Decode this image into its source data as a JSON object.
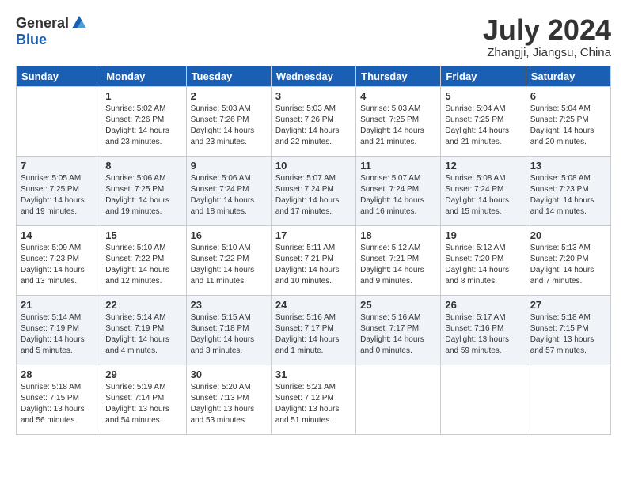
{
  "header": {
    "logo_general": "General",
    "logo_blue": "Blue",
    "month_title": "July 2024",
    "location": "Zhangji, Jiangsu, China"
  },
  "days_of_week": [
    "Sunday",
    "Monday",
    "Tuesday",
    "Wednesday",
    "Thursday",
    "Friday",
    "Saturday"
  ],
  "weeks": [
    [
      {
        "day": "",
        "info": ""
      },
      {
        "day": "1",
        "info": "Sunrise: 5:02 AM\nSunset: 7:26 PM\nDaylight: 14 hours\nand 23 minutes."
      },
      {
        "day": "2",
        "info": "Sunrise: 5:03 AM\nSunset: 7:26 PM\nDaylight: 14 hours\nand 23 minutes."
      },
      {
        "day": "3",
        "info": "Sunrise: 5:03 AM\nSunset: 7:26 PM\nDaylight: 14 hours\nand 22 minutes."
      },
      {
        "day": "4",
        "info": "Sunrise: 5:03 AM\nSunset: 7:25 PM\nDaylight: 14 hours\nand 21 minutes."
      },
      {
        "day": "5",
        "info": "Sunrise: 5:04 AM\nSunset: 7:25 PM\nDaylight: 14 hours\nand 21 minutes."
      },
      {
        "day": "6",
        "info": "Sunrise: 5:04 AM\nSunset: 7:25 PM\nDaylight: 14 hours\nand 20 minutes."
      }
    ],
    [
      {
        "day": "7",
        "info": "Sunrise: 5:05 AM\nSunset: 7:25 PM\nDaylight: 14 hours\nand 19 minutes."
      },
      {
        "day": "8",
        "info": "Sunrise: 5:06 AM\nSunset: 7:25 PM\nDaylight: 14 hours\nand 19 minutes."
      },
      {
        "day": "9",
        "info": "Sunrise: 5:06 AM\nSunset: 7:24 PM\nDaylight: 14 hours\nand 18 minutes."
      },
      {
        "day": "10",
        "info": "Sunrise: 5:07 AM\nSunset: 7:24 PM\nDaylight: 14 hours\nand 17 minutes."
      },
      {
        "day": "11",
        "info": "Sunrise: 5:07 AM\nSunset: 7:24 PM\nDaylight: 14 hours\nand 16 minutes."
      },
      {
        "day": "12",
        "info": "Sunrise: 5:08 AM\nSunset: 7:24 PM\nDaylight: 14 hours\nand 15 minutes."
      },
      {
        "day": "13",
        "info": "Sunrise: 5:08 AM\nSunset: 7:23 PM\nDaylight: 14 hours\nand 14 minutes."
      }
    ],
    [
      {
        "day": "14",
        "info": "Sunrise: 5:09 AM\nSunset: 7:23 PM\nDaylight: 14 hours\nand 13 minutes."
      },
      {
        "day": "15",
        "info": "Sunrise: 5:10 AM\nSunset: 7:22 PM\nDaylight: 14 hours\nand 12 minutes."
      },
      {
        "day": "16",
        "info": "Sunrise: 5:10 AM\nSunset: 7:22 PM\nDaylight: 14 hours\nand 11 minutes."
      },
      {
        "day": "17",
        "info": "Sunrise: 5:11 AM\nSunset: 7:21 PM\nDaylight: 14 hours\nand 10 minutes."
      },
      {
        "day": "18",
        "info": "Sunrise: 5:12 AM\nSunset: 7:21 PM\nDaylight: 14 hours\nand 9 minutes."
      },
      {
        "day": "19",
        "info": "Sunrise: 5:12 AM\nSunset: 7:20 PM\nDaylight: 14 hours\nand 8 minutes."
      },
      {
        "day": "20",
        "info": "Sunrise: 5:13 AM\nSunset: 7:20 PM\nDaylight: 14 hours\nand 7 minutes."
      }
    ],
    [
      {
        "day": "21",
        "info": "Sunrise: 5:14 AM\nSunset: 7:19 PM\nDaylight: 14 hours\nand 5 minutes."
      },
      {
        "day": "22",
        "info": "Sunrise: 5:14 AM\nSunset: 7:19 PM\nDaylight: 14 hours\nand 4 minutes."
      },
      {
        "day": "23",
        "info": "Sunrise: 5:15 AM\nSunset: 7:18 PM\nDaylight: 14 hours\nand 3 minutes."
      },
      {
        "day": "24",
        "info": "Sunrise: 5:16 AM\nSunset: 7:17 PM\nDaylight: 14 hours\nand 1 minute."
      },
      {
        "day": "25",
        "info": "Sunrise: 5:16 AM\nSunset: 7:17 PM\nDaylight: 14 hours\nand 0 minutes."
      },
      {
        "day": "26",
        "info": "Sunrise: 5:17 AM\nSunset: 7:16 PM\nDaylight: 13 hours\nand 59 minutes."
      },
      {
        "day": "27",
        "info": "Sunrise: 5:18 AM\nSunset: 7:15 PM\nDaylight: 13 hours\nand 57 minutes."
      }
    ],
    [
      {
        "day": "28",
        "info": "Sunrise: 5:18 AM\nSunset: 7:15 PM\nDaylight: 13 hours\nand 56 minutes."
      },
      {
        "day": "29",
        "info": "Sunrise: 5:19 AM\nSunset: 7:14 PM\nDaylight: 13 hours\nand 54 minutes."
      },
      {
        "day": "30",
        "info": "Sunrise: 5:20 AM\nSunset: 7:13 PM\nDaylight: 13 hours\nand 53 minutes."
      },
      {
        "day": "31",
        "info": "Sunrise: 5:21 AM\nSunset: 7:12 PM\nDaylight: 13 hours\nand 51 minutes."
      },
      {
        "day": "",
        "info": ""
      },
      {
        "day": "",
        "info": ""
      },
      {
        "day": "",
        "info": ""
      }
    ]
  ]
}
